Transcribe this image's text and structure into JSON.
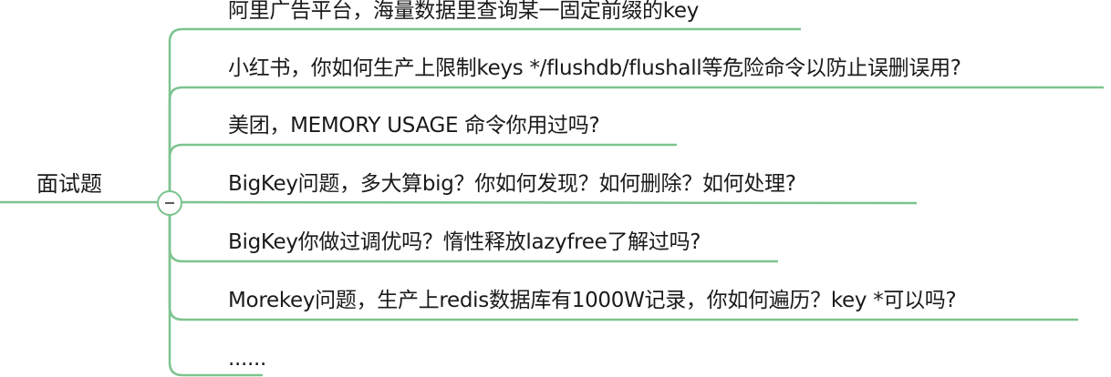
{
  "colors": {
    "branch": "#7cc38e",
    "text": "#1a1a1a",
    "background": "#ffffff"
  },
  "root": {
    "label": "面试题",
    "collapse_icon": "minus-icon"
  },
  "topics": [
    {
      "label": "阿里广告平台，海量数据里查询某一固定前缀的key"
    },
    {
      "label": "小红书，你如何生产上限制keys */flushdb/flushall等危险命令以防止误删误用?"
    },
    {
      "label": "美团，MEMORY USAGE 命令你用过吗?"
    },
    {
      "label": "BigKey问题，多大算big？你如何发现？如何删除？如何处理?"
    },
    {
      "label": "BigKey你做过调优吗？惰性释放lazyfree了解过吗?"
    },
    {
      "label": "Morekey问题，生产上redis数据库有1000W记录，你如何遍历？key *可以吗?"
    },
    {
      "label": "......"
    }
  ]
}
